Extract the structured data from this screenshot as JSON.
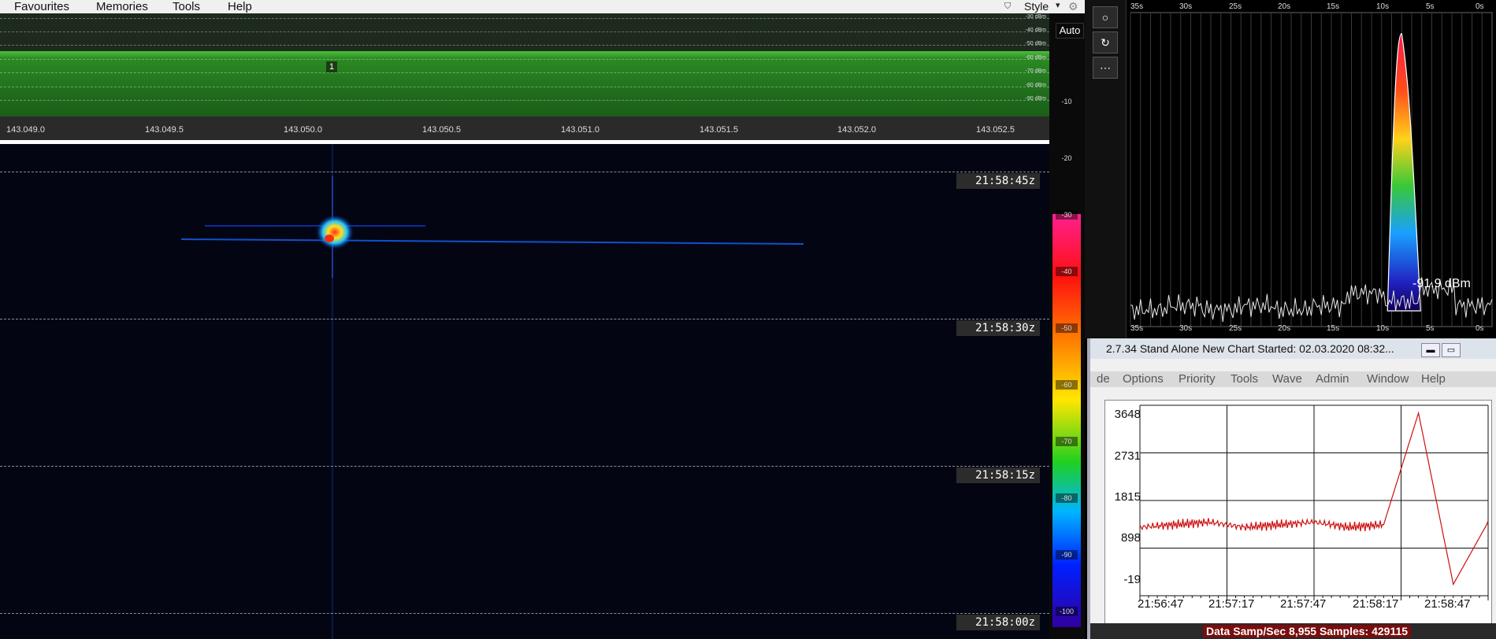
{
  "menubar": {
    "items": [
      "Favourites",
      "Memories",
      "Tools",
      "Help"
    ],
    "style_label": "Style"
  },
  "spectrum": {
    "dbm_labels": [
      "-30 dBm",
      "-40 dBm",
      "-50 dBm",
      "-60 dBm",
      "-70 dBm",
      "-80 dBm",
      "-90 dBm"
    ],
    "marker_label": "1",
    "freq_labels": [
      "143.049.0",
      "143.049.5",
      "143.050.0",
      "143.050.5",
      "143.051.0",
      "143.051.5",
      "143.052.0",
      "143.052.5"
    ]
  },
  "waterfall": {
    "timestamps": [
      "21:58:45z",
      "21:58:30z",
      "21:58:15z",
      "21:58:00z"
    ]
  },
  "colorbar": {
    "auto_label": "Auto",
    "scale_labels": [
      "-10",
      "-20",
      "-30",
      "-40",
      "-50",
      "-60",
      "-70",
      "-80",
      "-90",
      "-100"
    ]
  },
  "realtime_chart": {
    "time_labels": [
      "35s",
      "30s",
      "25s",
      "20s",
      "15s",
      "10s",
      "5s",
      "0s"
    ],
    "readout": "-91.9 dBm"
  },
  "side_tools": {
    "buttons": [
      "circle-icon",
      "refresh-icon",
      "more-icon"
    ]
  },
  "lower_window": {
    "title": "2.7.34  Stand Alone  New Chart Started: 02.03.2020 08:32...",
    "menu": [
      "de",
      "Options",
      "Priority",
      "Tools",
      "Wave",
      "Admin",
      "Window",
      "Help"
    ],
    "status": "Data Samp/Sec 8,955  Samples: 429115"
  },
  "chart_data": [
    {
      "type": "line",
      "x": [
        "35s",
        "30s",
        "25s",
        "20s",
        "15s",
        "10s",
        "5s",
        "0s"
      ],
      "ylabel": "",
      "readout": "-91.9 dBm",
      "series": [
        {
          "values": [
            -96,
            -95,
            -96,
            -95,
            -96,
            -95,
            -92,
            -30,
            -91,
            -95
          ]
        }
      ]
    },
    {
      "type": "line",
      "categories": [
        "21:56:47",
        "21:57:17",
        "21:57:47",
        "21:58:17",
        "21:58:47"
      ],
      "y_ticks": [
        "3648",
        "2731",
        "1815",
        "898",
        "-19"
      ],
      "ylim": [
        -19,
        3648
      ],
      "series": [
        {
          "values": [
            1300,
            1350,
            1400,
            1300,
            1350,
            1400,
            1300,
            1350,
            3500,
            200,
            1400
          ]
        }
      ]
    }
  ]
}
